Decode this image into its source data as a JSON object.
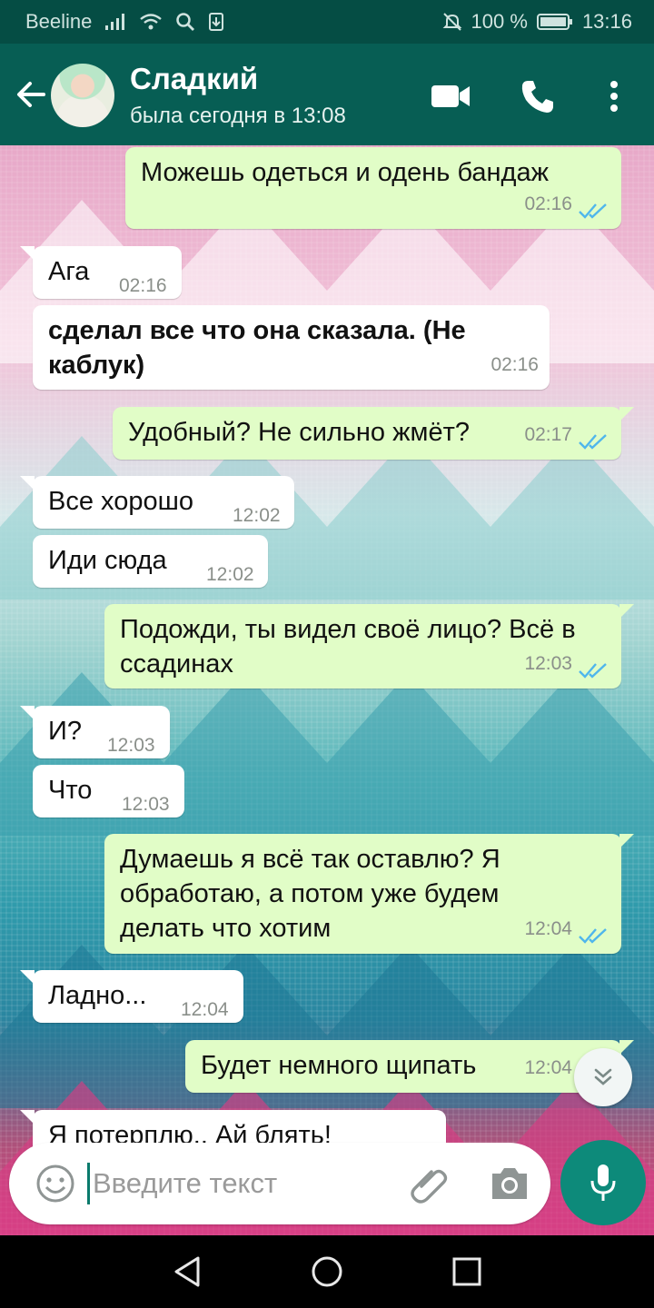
{
  "status_bar": {
    "carrier": "Beeline",
    "battery": "100 %",
    "time": "13:16",
    "icons": [
      "signal-icon",
      "wifi-icon",
      "search-icon",
      "download-icon",
      "mute-icon",
      "battery-icon"
    ]
  },
  "header": {
    "contact_name": "Сладкий",
    "last_seen": "была сегодня в 13:08",
    "icons": [
      "back-arrow-icon",
      "video-call-icon",
      "phone-icon",
      "more-vertical-icon"
    ]
  },
  "messages": [
    {
      "direction": "out",
      "text": "Можешь одеться и  одень бандаж",
      "time": "02:16",
      "status": "read"
    },
    {
      "direction": "in",
      "text": "Ага",
      "time": "02:16"
    },
    {
      "direction": "in",
      "text": "сделал все что она сказала. (Не каблук)",
      "time": "02:16",
      "bold": true
    },
    {
      "direction": "out",
      "text": "Удобный? Не сильно жмёт?",
      "time": "02:17",
      "status": "read"
    },
    {
      "direction": "in",
      "text": "Все хорошо",
      "time": "12:02"
    },
    {
      "direction": "in",
      "text": "Иди сюда",
      "time": "12:02"
    },
    {
      "direction": "out",
      "text": "Подожди, ты видел своё лицо? Всё в ссадинах",
      "time": "12:03",
      "status": "read"
    },
    {
      "direction": "in",
      "text": "И?",
      "time": "12:03"
    },
    {
      "direction": "in",
      "text": "Что",
      "time": "12:03"
    },
    {
      "direction": "out",
      "text": "Думаешь я всё так оставлю? Я обработаю, а потом уже будем делать что хотим",
      "time": "12:04",
      "status": "read"
    },
    {
      "direction": "in",
      "text": "Ладно...",
      "time": "12:04"
    },
    {
      "direction": "out",
      "text": "Будет немного щипать",
      "time": "12:04",
      "status": "read"
    },
    {
      "direction": "in",
      "text": "Я потерплю.. Ай блять!",
      "time": "",
      "partially_visible": true
    }
  ],
  "composer": {
    "placeholder": "Введите текст",
    "icons": [
      "emoji-icon",
      "attach-icon",
      "camera-icon",
      "mic-icon"
    ]
  },
  "colors": {
    "header": "#075e54",
    "status_bar": "#054d44",
    "outgoing_bubble": "#e1fdc7",
    "incoming_bubble": "#ffffff",
    "read_ticks": "#4fb6ec",
    "mic_button": "#0d8a7a"
  }
}
